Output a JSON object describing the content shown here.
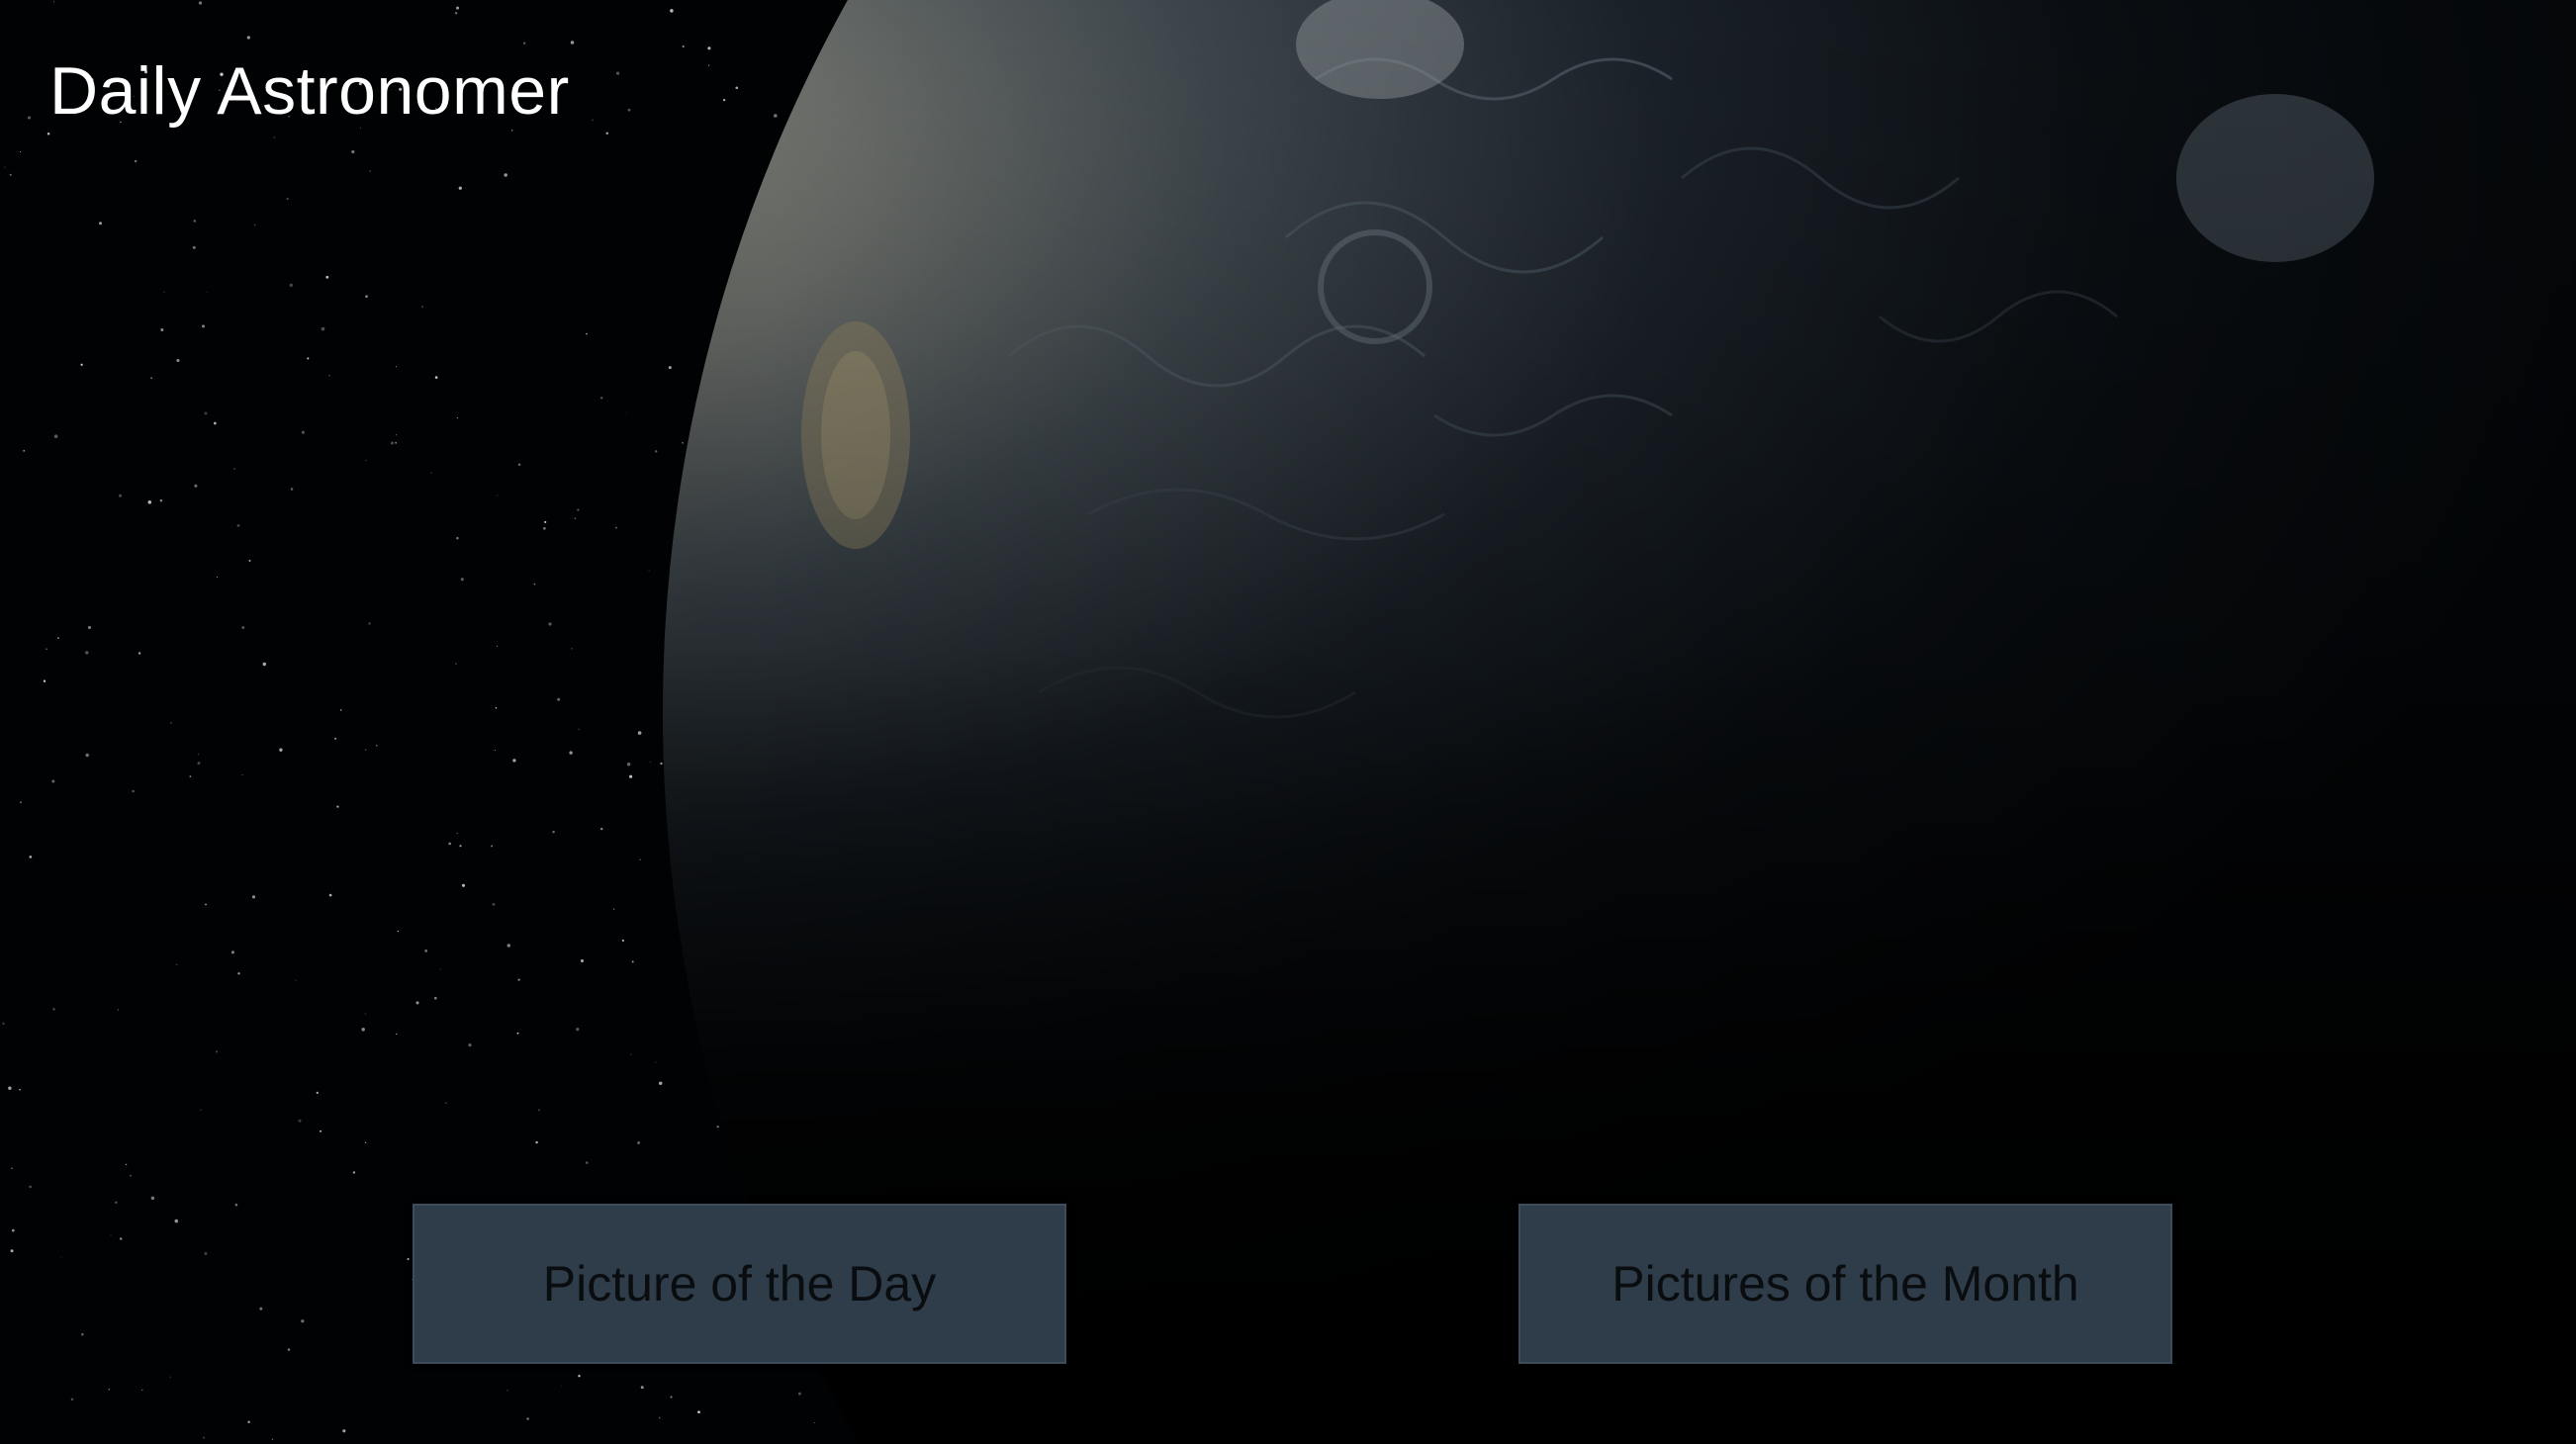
{
  "app": {
    "title": "Daily Astronomer"
  },
  "background": {
    "image": "jupiter-planet-image",
    "starfield": "starfield-background"
  },
  "buttons": {
    "picture_of_the_day": "Picture of the Day",
    "pictures_of_the_month": "Pictures of the Month"
  },
  "colors": {
    "background": "#010203",
    "title_text": "#ffffff",
    "button_fill": "#2f3d4a",
    "button_text": "#0a0d10"
  }
}
